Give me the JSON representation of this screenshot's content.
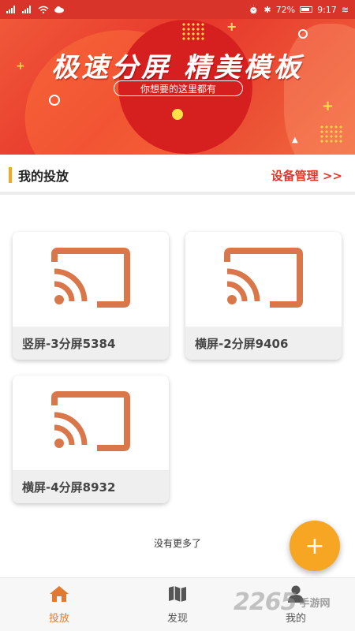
{
  "status_bar": {
    "battery": "72%",
    "time": "9:17"
  },
  "banner": {
    "title": "极速分屏 精美模板",
    "subtitle": "你想要的这里都有"
  },
  "section": {
    "title": "我的投放",
    "manage_link": "设备管理 >>"
  },
  "cards": [
    {
      "label": "竖屏-3分屏5384",
      "icon": "cast-icon"
    },
    {
      "label": "横屏-2分屏9406",
      "icon": "cast-icon"
    },
    {
      "label": "横屏-4分屏8932",
      "icon": "cast-icon"
    }
  ],
  "list_footer": "没有更多了",
  "fab_label": "+",
  "bottom_nav": [
    {
      "label": "投放",
      "icon": "home-icon",
      "active": true
    },
    {
      "label": "发现",
      "icon": "map-icon",
      "active": false
    },
    {
      "label": "我的",
      "icon": "user-icon",
      "active": false
    }
  ],
  "watermark": {
    "number": "2265",
    "text": "手游网"
  },
  "colors": {
    "brand_red": "#e0362b",
    "accent_orange": "#f6a623",
    "cast_icon": "#d9774a",
    "nav_active": "#e07a30"
  }
}
